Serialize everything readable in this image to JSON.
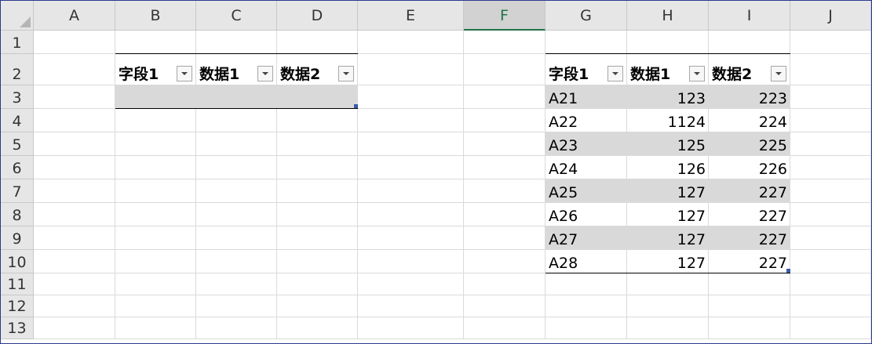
{
  "columns": [
    "A",
    "B",
    "C",
    "D",
    "E",
    "F",
    "G",
    "H",
    "I",
    "J"
  ],
  "rows": [
    "1",
    "2",
    "3",
    "4",
    "5",
    "6",
    "7",
    "8",
    "9",
    "10",
    "11",
    "12",
    "13"
  ],
  "selected_column": "F",
  "table1": {
    "headers": [
      "字段1",
      "数据1",
      "数据2"
    ]
  },
  "table2": {
    "headers": [
      "字段1",
      "数据1",
      "数据2"
    ],
    "rows": [
      [
        "A21",
        "123",
        "223"
      ],
      [
        "A22",
        "1124",
        "224"
      ],
      [
        "A23",
        "125",
        "225"
      ],
      [
        "A24",
        "126",
        "226"
      ],
      [
        "A25",
        "127",
        "227"
      ],
      [
        "A26",
        "127",
        "227"
      ],
      [
        "A27",
        "127",
        "227"
      ],
      [
        "A28",
        "127",
        "227"
      ]
    ]
  },
  "colors": {
    "band": "#d9d9d9",
    "selected_col_accent": "#217346",
    "frame": "#2b3a8f"
  },
  "icons": {
    "filter": "dropdown-arrow-icon",
    "select_all": "select-all-triangle-icon"
  }
}
